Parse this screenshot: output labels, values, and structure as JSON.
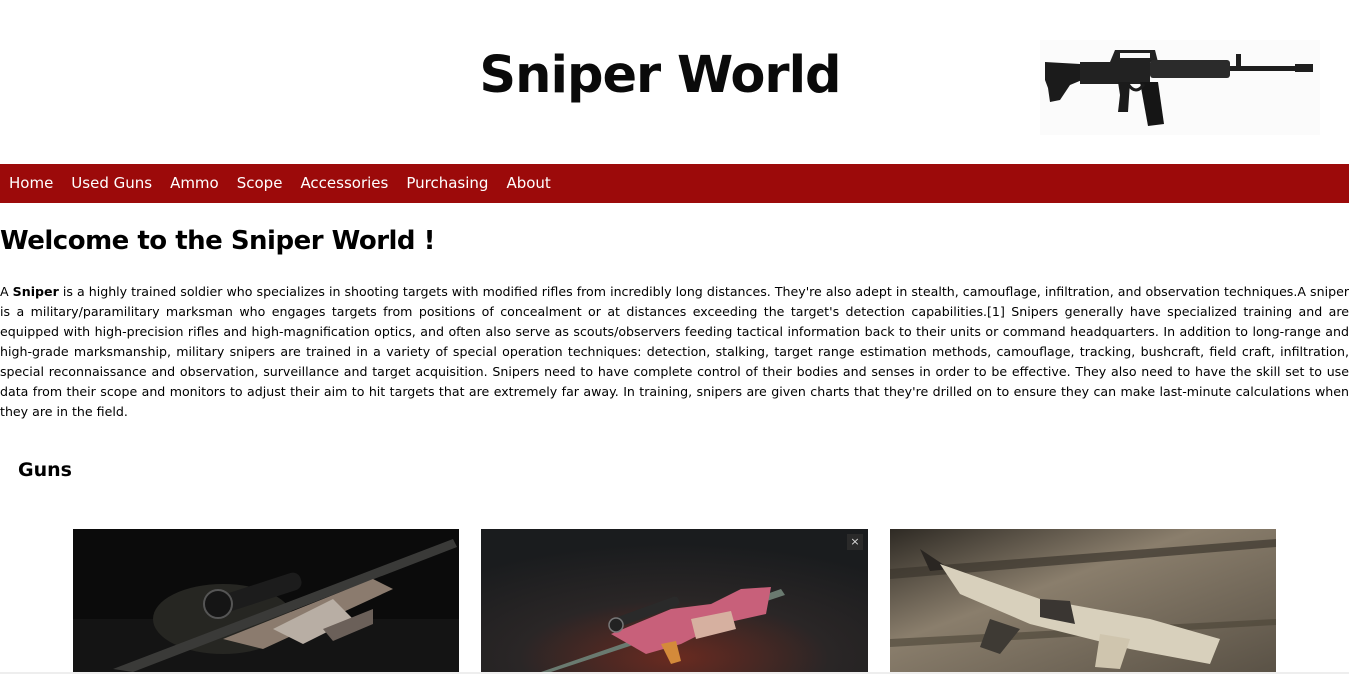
{
  "header": {
    "title": "Sniper World",
    "logo_icon": "assault-rifle-icon"
  },
  "nav": {
    "items": [
      {
        "label": "Home"
      },
      {
        "label": "Used Guns"
      },
      {
        "label": "Ammo"
      },
      {
        "label": "Scope"
      },
      {
        "label": "Accessories"
      },
      {
        "label": "Purchasing"
      },
      {
        "label": "About"
      }
    ],
    "background_color": "#9c0a0a"
  },
  "main": {
    "heading": "Welcome to the Sniper World !",
    "intro": {
      "lead": "A ",
      "bold": "Sniper",
      "rest": " is a highly trained soldier who specializes in shooting targets with modified rifles from incredibly long distances. They're also adept in stealth, camouflage, infiltration, and observation techniques.A sniper is a military/paramilitary marksman who engages targets from positions of concealment or at distances exceeding the target's detection capabilities.[1] Snipers generally have specialized training and are equipped with high-precision rifles and high-magnification optics, and often also serve as scouts/observers feeding tactical information back to their units or command headquarters. In addition to long-range and high-grade marksmanship, military snipers are trained in a variety of special operation techniques: detection, stalking, target range estimation methods, camouflage, tracking, bushcraft, field craft, infiltration, special reconnaissance and observation, surveillance and target acquisition. Snipers need to have complete control of their bodies and senses in order to be effective. They also need to have the skill set to use data from their scope and monitors to adjust their aim to hit targets that are extremely far away. In training, snipers are given charts that they're drilled on to ensure they can make last-minute calculations when they are in the field."
    },
    "guns_heading": "Guns",
    "gallery": {
      "close_label": "×",
      "cards": [
        {
          "icon": "sniper-rifle-image"
        },
        {
          "icon": "awp-rifle-image"
        },
        {
          "icon": "sks-rifle-image"
        }
      ]
    }
  }
}
